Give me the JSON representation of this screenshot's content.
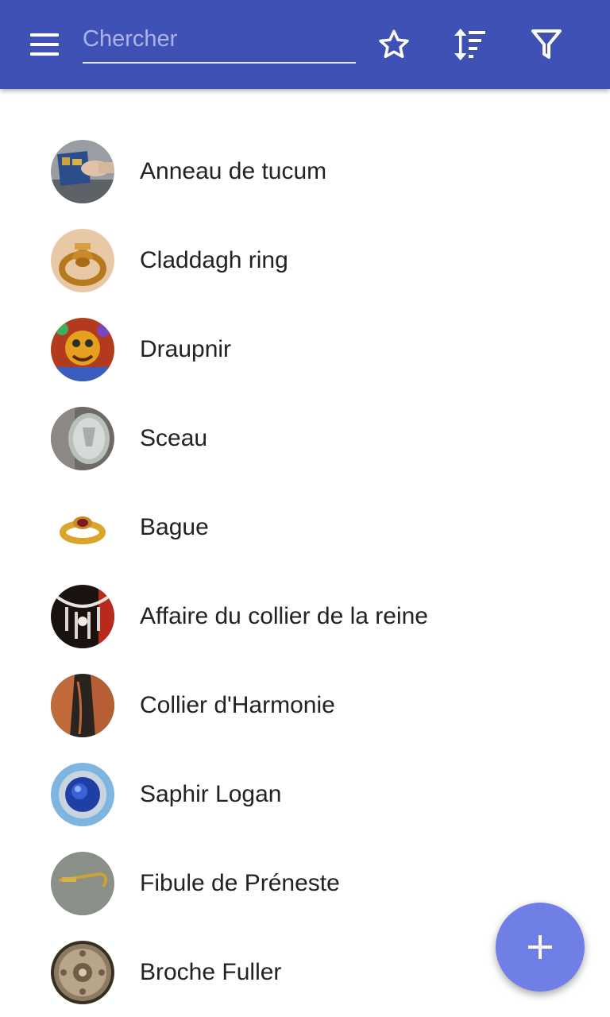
{
  "toolbar": {
    "menu_icon": "hamburger-menu-icon",
    "search_placeholder": "Chercher",
    "search_value": "",
    "favorite_icon": "star-outline-icon",
    "sort_icon": "sort-icon",
    "filter_icon": "filter-icon",
    "color": "#3f51b5"
  },
  "items": [
    {
      "label": "Anneau de tucum",
      "thumb": "tucum-ring-photo"
    },
    {
      "label": "Claddagh ring",
      "thumb": "claddagh-ring-photo"
    },
    {
      "label": "Draupnir",
      "thumb": "draupnir-illustration"
    },
    {
      "label": "Sceau",
      "thumb": "seal-ring-photo"
    },
    {
      "label": "Bague",
      "thumb": "gold-ring-photo"
    },
    {
      "label": "Affaire du collier de la reine",
      "thumb": "queens-necklace-photo"
    },
    {
      "label": "Collier d'Harmonie",
      "thumb": "greek-vase-photo"
    },
    {
      "label": "Saphir Logan",
      "thumb": "logan-sapphire-photo"
    },
    {
      "label": "Fibule de Préneste",
      "thumb": "praeneste-fibula-photo"
    },
    {
      "label": "Broche Fuller",
      "thumb": "fuller-brooch-photo"
    }
  ],
  "fab": {
    "icon": "plus-icon",
    "color": "#6f7fe6"
  }
}
